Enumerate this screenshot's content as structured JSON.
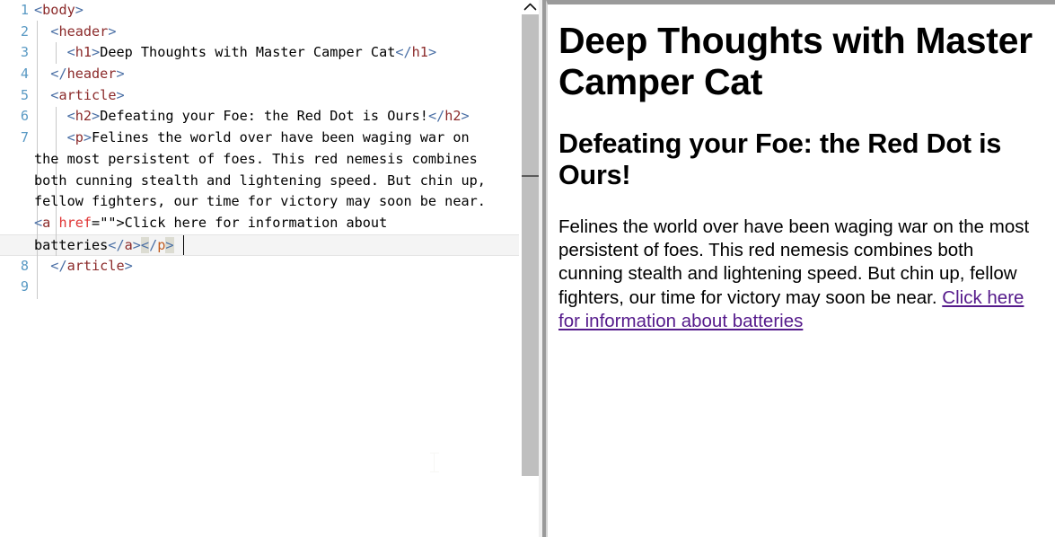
{
  "editor": {
    "language": "html",
    "gutter_color": "#5a9ac4",
    "active_line_number": 7,
    "lines": [
      {
        "number": "1",
        "indent_level": 0
      },
      {
        "number": "2",
        "indent_level": 1
      },
      {
        "number": "3",
        "indent_level": 2
      },
      {
        "number": "4",
        "indent_level": 1
      },
      {
        "number": "5",
        "indent_level": 1
      },
      {
        "number": "6",
        "indent_level": 2
      },
      {
        "number": "7",
        "indent_level": 2
      },
      {
        "number": "8",
        "indent_level": 1
      },
      {
        "number": "9",
        "indent_level": 0
      }
    ],
    "code_text": {
      "l1": "<body>",
      "l2": "<header>",
      "l3_open": "<h1>",
      "l3_text": "Deep Thoughts with Master Camper Cat",
      "l3_close": "</h1>",
      "l4": "</header>",
      "l5": "<article>",
      "l6_open": "<h2>",
      "l6_text": "Defeating your Foe: the Red Dot is Ours!",
      "l6_close": "</h2>",
      "l7_open": "<p>",
      "l7_wrap1": "Felines the world over have been waging war on",
      "l7_wrap2": "the most persistent of foes. This red nemesis combines",
      "l7_wrap3": "both cunning stealth and lightening speed. But chin up,",
      "l7_wrap4": "fellow fighters, our time for victory may soon be near.",
      "l7_a_tag": "a",
      "l7_a_attr": "href",
      "l7_a_val": "=\"\"",
      "l7_a_text": ">Click here for information about",
      "l7_wrap5_text": "batteries",
      "l7_a_close": "</a>",
      "l7_p_close_name": "p",
      "l8": "</article>",
      "l9": ""
    },
    "syntax_colors": {
      "bracket": "#4a6fa5",
      "tag_name": "#8b2a2a",
      "attribute": "#e03535",
      "attribute_value": "#000000",
      "text": "#000000",
      "bracket_match_highlight": "#dcdcd2",
      "active_line_bg": "#f4f4f4"
    },
    "scrollbar": {
      "up_arrow_icon": "chevron-up-icon",
      "thumb_color": "#bfbfbf",
      "track_color": "#ffffff"
    }
  },
  "preview": {
    "h1": "Deep Thoughts with Master Camper Cat",
    "h2": "Defeating your Foe: the Red Dot is Ours!",
    "paragraph_before_link": "Felines the world over have been waging war on the most persistent of foes. This red nemesis combines both cunning stealth and lightening speed. But chin up, fellow fighters, our time for victory may soon be near. ",
    "link_text": "Click here for information about batteries",
    "link_color": "#551a8b"
  }
}
